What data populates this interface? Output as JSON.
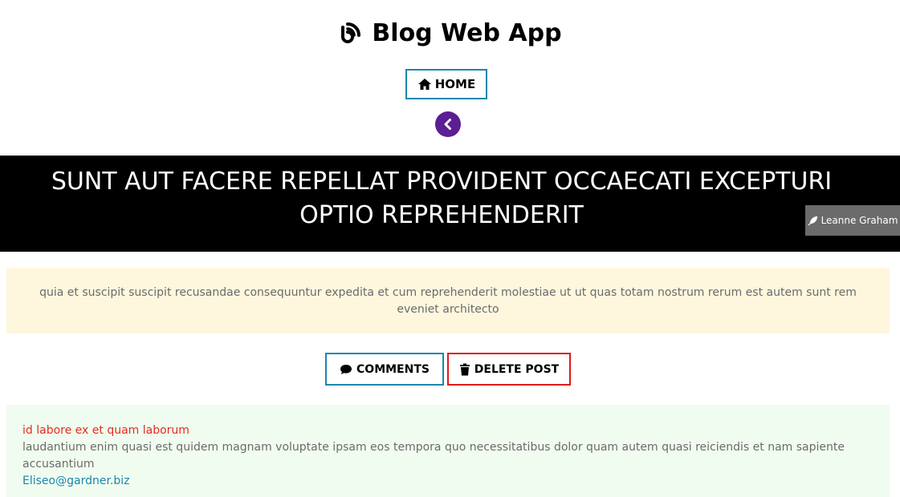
{
  "header": {
    "title": "Blog Web App",
    "logo_icon": "blog-rss-icon"
  },
  "nav": {
    "home_label": "HOME",
    "home_icon": "house-icon",
    "back_icon": "chevron-left-circle-icon"
  },
  "post": {
    "title": "SUNT AUT FACERE REPELLAT PROVIDENT OCCAECATI EXCEPTURI OPTIO REPREHENDERIT",
    "author": "Leanne Graham",
    "author_icon": "feather-pen-icon",
    "body": "quia et suscipit suscipit recusandae consequuntur expedita et cum reprehenderit molestiae ut ut quas totam nostrum rerum est autem sunt rem eveniet architecto"
  },
  "actions": {
    "comments_label": "COMMENTS",
    "comments_icon": "comment-bubble-icon",
    "delete_label": "DELETE POST",
    "delete_icon": "trash-icon"
  },
  "comments": [
    {
      "name": "id labore ex et quam laborum",
      "body": "laudantium enim quasi est quidem magnam voluptate ipsam eos tempora quo necessitatibus dolor quam autem quasi reiciendis et nam sapiente accusantium",
      "email": "Eliseo@gardner.biz"
    }
  ],
  "colors": {
    "home_border": "#1a86ad",
    "back_button": "#5b1e93",
    "delete_border": "#dd1b1b",
    "post_body_bg": "#fef7de",
    "comment_bg": "#f1fcf0",
    "comment_name": "#e52d1d",
    "comment_email": "#1a86ad"
  }
}
